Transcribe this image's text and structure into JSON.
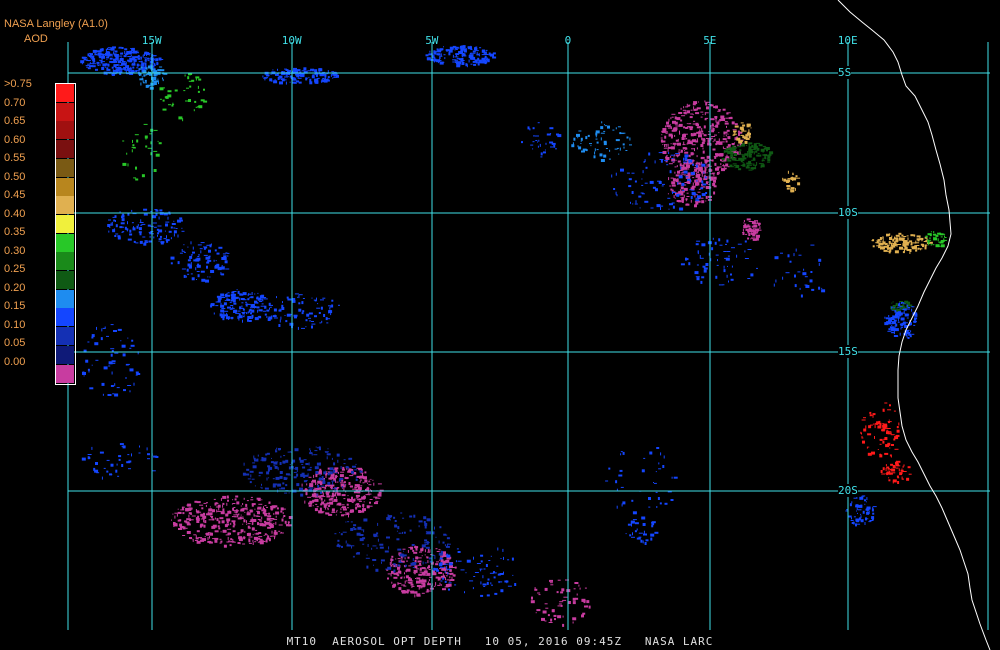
{
  "header": {
    "source": "NASA Langley (A1.0)",
    "variable": "AOD"
  },
  "legend": {
    "labels": [
      ">0.75",
      "0.70",
      "0.65",
      "0.60",
      "0.55",
      "0.50",
      "0.45",
      "0.40",
      "0.35",
      "0.30",
      "0.25",
      "0.20",
      "0.15",
      "0.10",
      "0.05",
      "0.00"
    ],
    "colors": [
      "#ff1a1a",
      "#c81414",
      "#a01010",
      "#7a1010",
      "#7a5a14",
      "#b8861e",
      "#e0b050",
      "#f0f03c",
      "#28c828",
      "#1a8a1a",
      "#0f5a14",
      "#1e8cf0",
      "#1446ff",
      "#1430b4",
      "#0f1a78",
      "#c83ca0"
    ]
  },
  "axes": {
    "lon_labels": [
      "15W",
      "10W",
      "5W",
      "0",
      "5E",
      "10E"
    ],
    "lat_labels": [
      "5S",
      "10S",
      "15S",
      "20S"
    ]
  },
  "colors": {
    "grid": "#40e0e8",
    "coast": "#ffffff",
    "legend_text": "#f0a050",
    "footer_text": "#e0e0e0"
  },
  "footer": {
    "text": "MT10  AEROSOL OPT DEPTH   10 05, 2016 09:45Z   NASA LARC"
  }
}
